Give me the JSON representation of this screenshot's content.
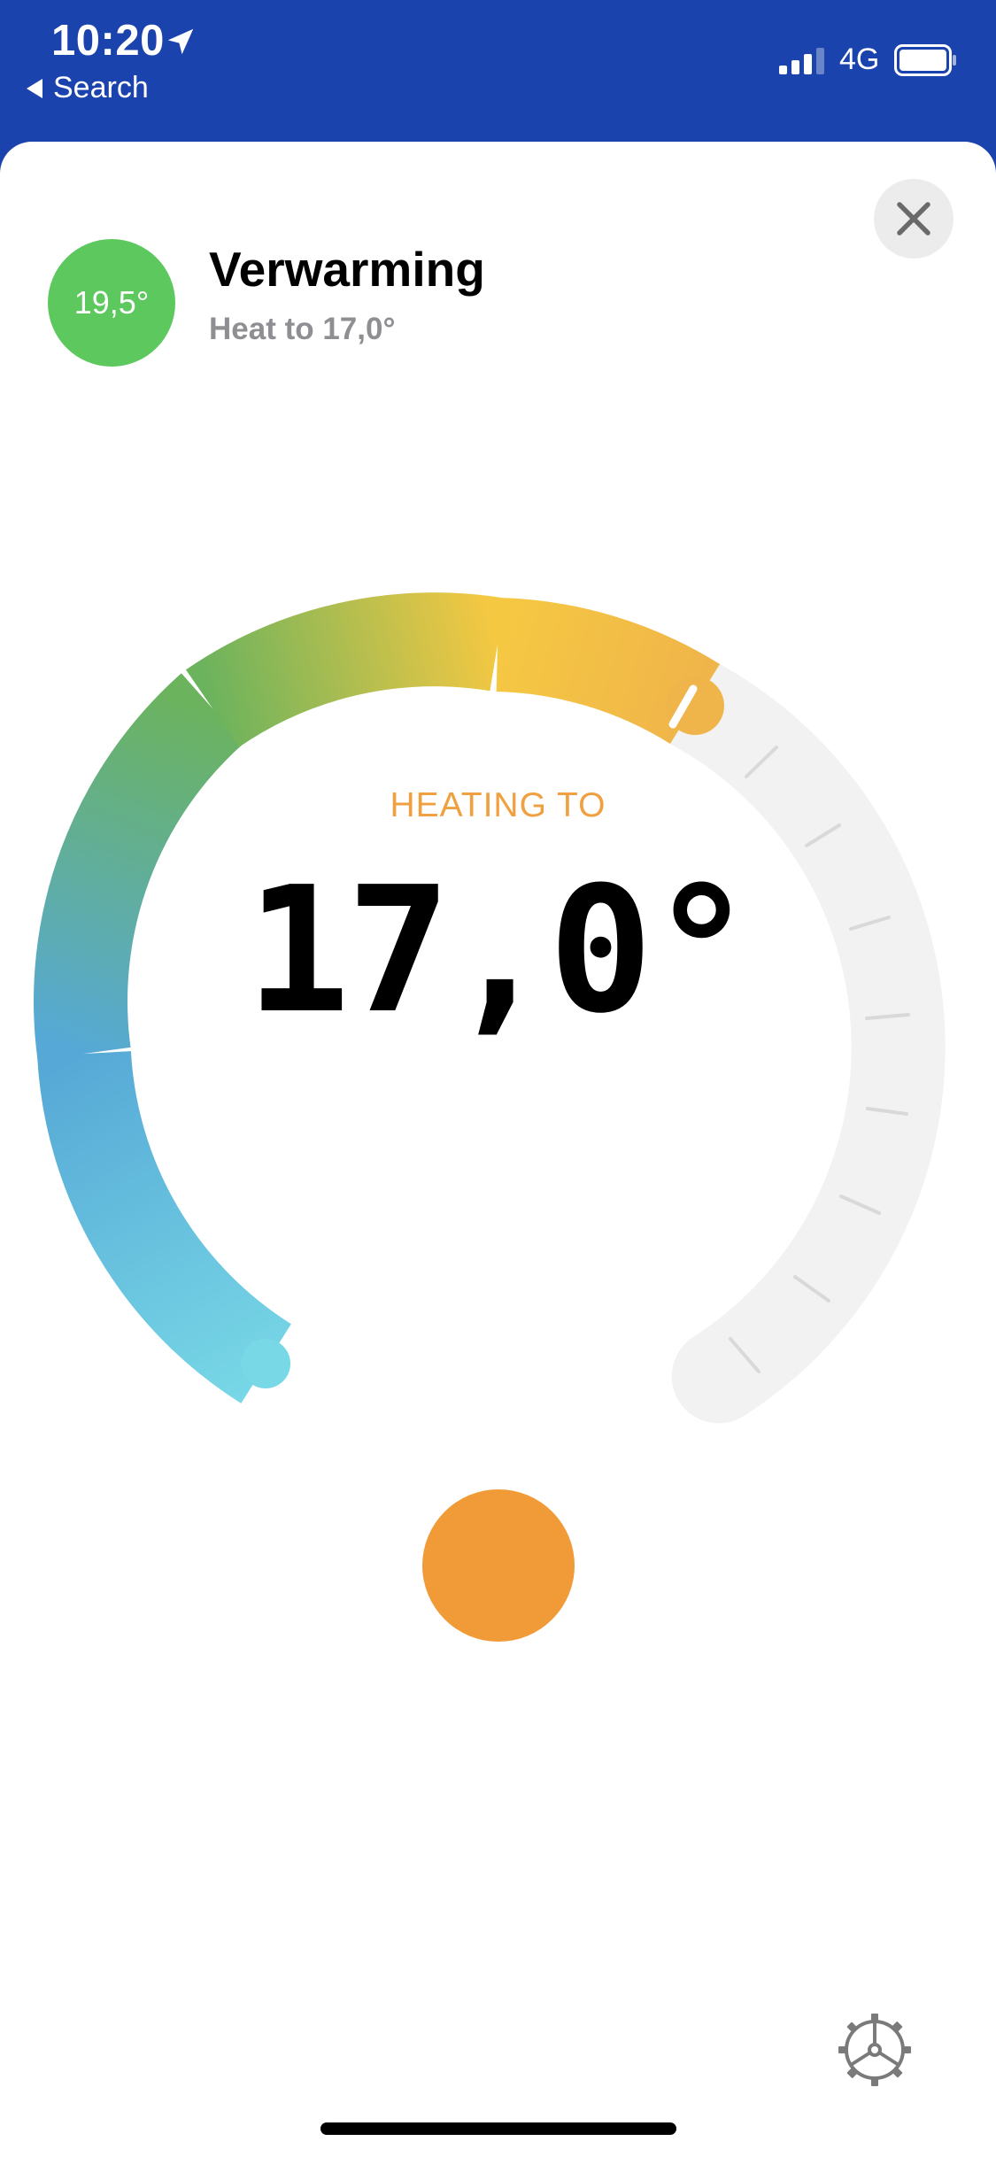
{
  "status_bar": {
    "time": "10:20",
    "back_label": "Search",
    "network": "4G",
    "icons": [
      "location-arrow-icon",
      "signal-icon",
      "battery-icon"
    ]
  },
  "header": {
    "current_temperature": "19,5°",
    "title": "Verwarming",
    "subtitle": "Heat to 17,0°",
    "close_icon": "close-icon"
  },
  "thermostat": {
    "mode_label": "HEATING TO",
    "target_temperature": "17,0°",
    "dial_fill_fraction": 0.5,
    "colors": {
      "cool": "#78d8e6",
      "mid": "#56a9d6",
      "green": "#6cb35d",
      "yellow": "#f5c842",
      "warm": "#f0b54a",
      "track": "#f2f2f2"
    }
  },
  "actions": {
    "primary_color": "#f09b37",
    "settings_icon": "gear-icon"
  },
  "colors": {
    "nav_background": "#1b43ae",
    "badge_green": "#5cc85d",
    "accent_orange": "#f0a040"
  }
}
